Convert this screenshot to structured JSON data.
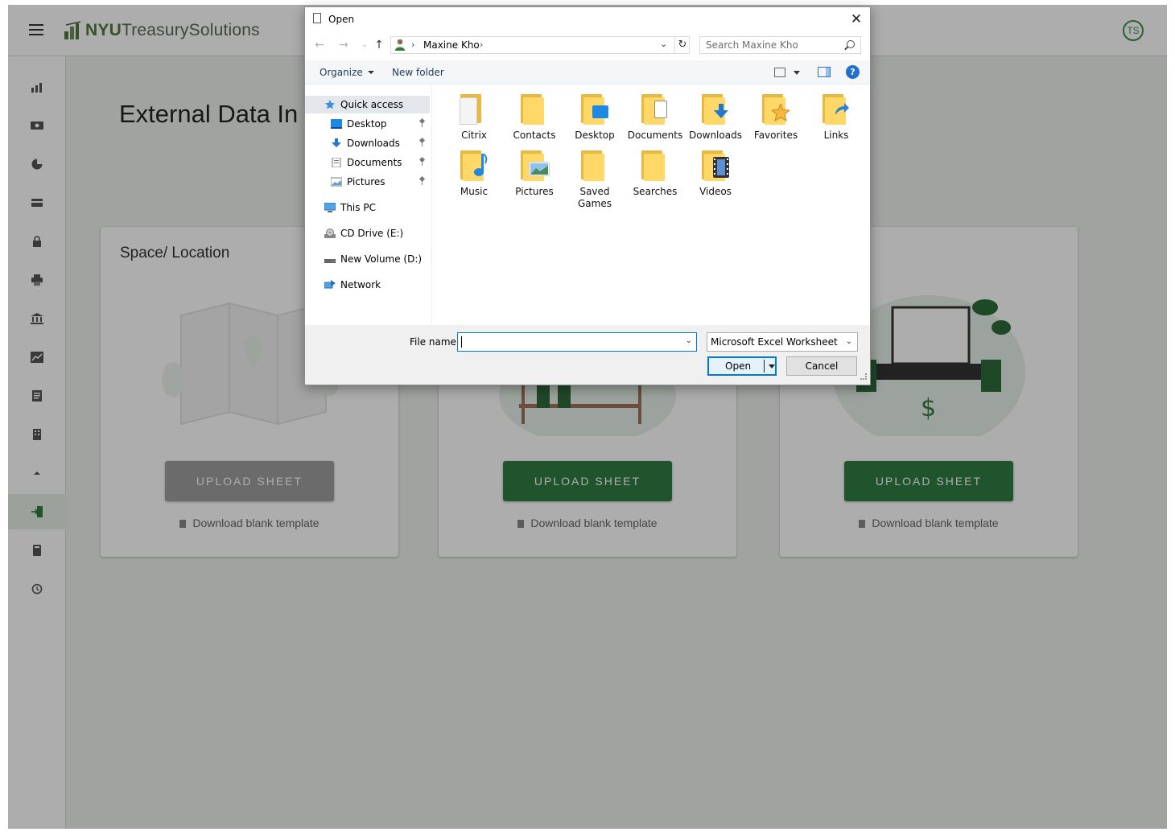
{
  "app": {
    "logo_bold": "NYU",
    "logo_rest": "TreasurySolutions",
    "avatar_initials": "TS",
    "page_title": "External Data In",
    "cards": [
      {
        "title": "Space/ Location",
        "upload_label": "UPLOAD SHEET",
        "template_label": "Download blank template"
      },
      {
        "title": "",
        "upload_label": "UPLOAD SHEET",
        "template_label": "Download blank template"
      },
      {
        "title": "",
        "upload_label": "UPLOAD SHEET",
        "template_label": "Download blank template"
      }
    ],
    "sidebar_icons": [
      "chart-icon",
      "money-icon",
      "pie-chart-icon",
      "card-icon",
      "lock-icon",
      "printer-icon",
      "bank-icon",
      "line-chart-icon",
      "report-icon",
      "building-icon",
      "collapse-icon",
      "import-icon",
      "book-icon",
      "history-icon"
    ],
    "colors": {
      "brand_green": "#2e7d43",
      "accent_green": "#3f8e4c"
    }
  },
  "dialog": {
    "title": "Open",
    "breadcrumb": "Maxine Kho",
    "search_placeholder": "Search Maxine Kho",
    "toolbar": {
      "organize": "Organize",
      "new_folder": "New folder",
      "help": "?"
    },
    "nav": {
      "quick_access": "Quick access",
      "pinned": [
        "Desktop",
        "Downloads",
        "Documents",
        "Pictures"
      ],
      "this_pc": "This PC",
      "cd_drive": "CD Drive (E:)",
      "new_volume": "New Volume (D:)",
      "network": "Network"
    },
    "folders": [
      "Citrix",
      "Contacts",
      "Desktop",
      "Documents",
      "Downloads",
      "Favorites",
      "Links",
      "Music",
      "Pictures",
      "Saved Games",
      "Searches",
      "Videos"
    ],
    "file_name_label": "File name:",
    "file_name_value": "",
    "file_type": "Microsoft Excel Worksheet",
    "open_label": "Open",
    "cancel_label": "Cancel"
  }
}
